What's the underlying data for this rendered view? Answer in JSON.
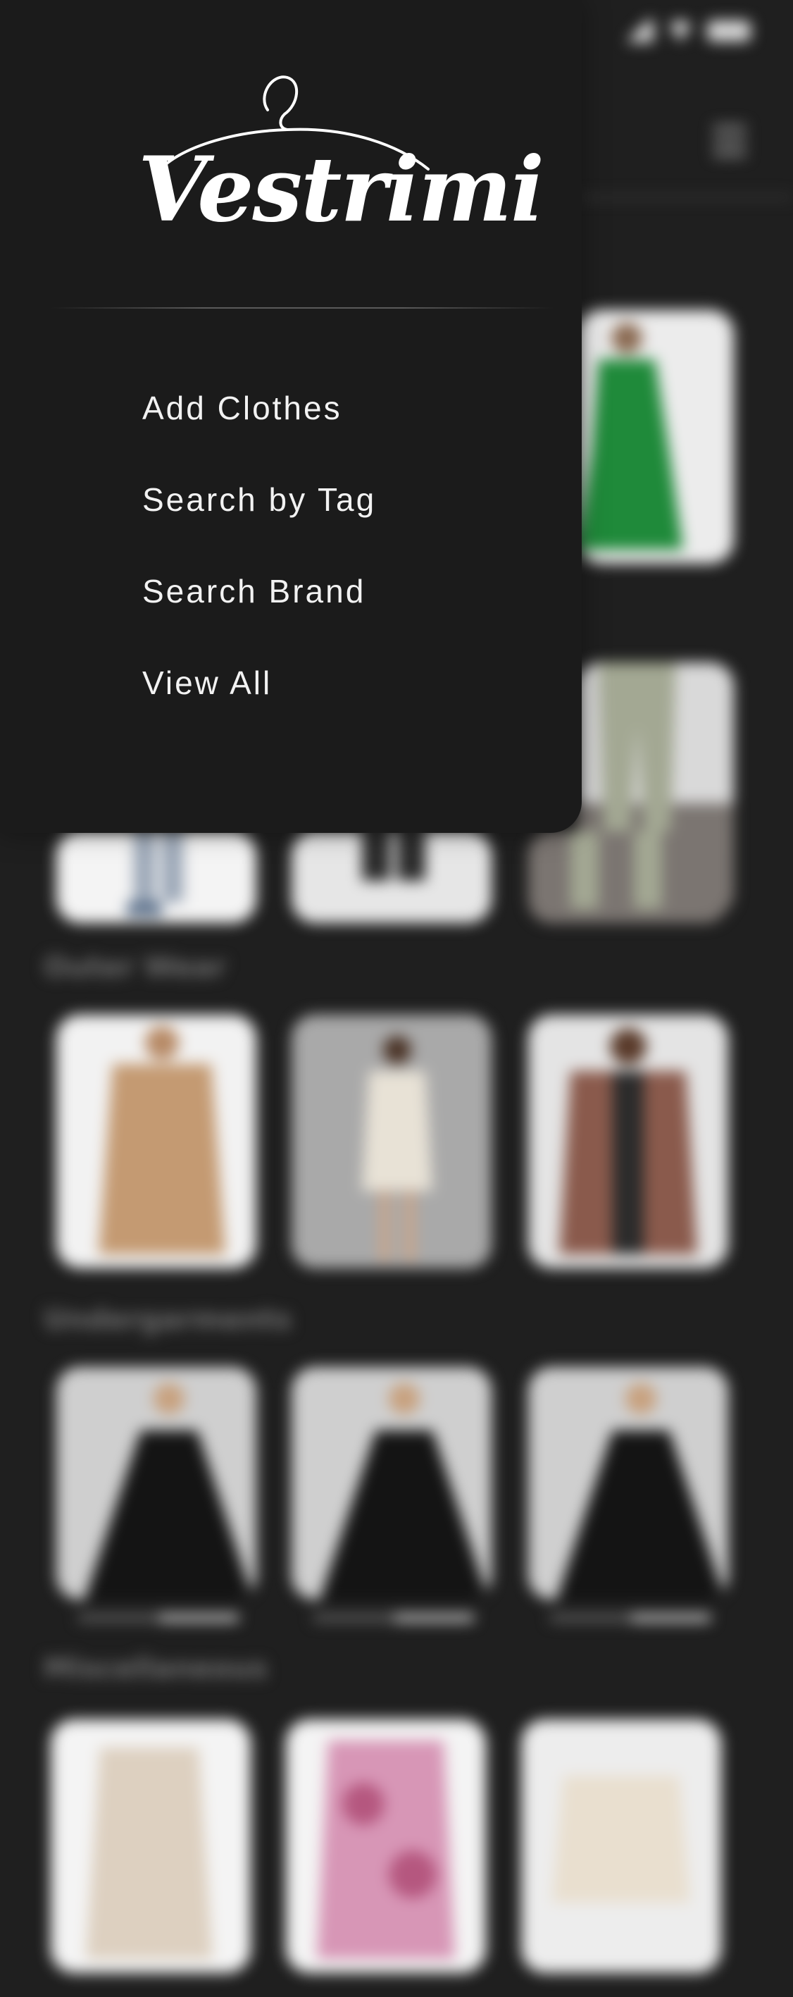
{
  "app": {
    "brand": "Vestrimi"
  },
  "drawer": {
    "menu": [
      {
        "label": "Add Clothes"
      },
      {
        "label": "Search by Tag"
      },
      {
        "label": "Search Brand"
      },
      {
        "label": "View All"
      }
    ]
  },
  "background": {
    "categories": [
      {
        "label": "Outer Wear"
      },
      {
        "label": "Undergarments"
      },
      {
        "label": "Miscellaneous"
      }
    ]
  },
  "icons": {
    "status": [
      "signal-icon",
      "wifi-icon",
      "battery-icon"
    ],
    "menu": "hamburger-menu-icon",
    "logo": "hanger-logo-icon"
  },
  "colors": {
    "background": "#1f1f1f",
    "drawer": "#1b1b1b",
    "text": "#f2f2f2"
  }
}
